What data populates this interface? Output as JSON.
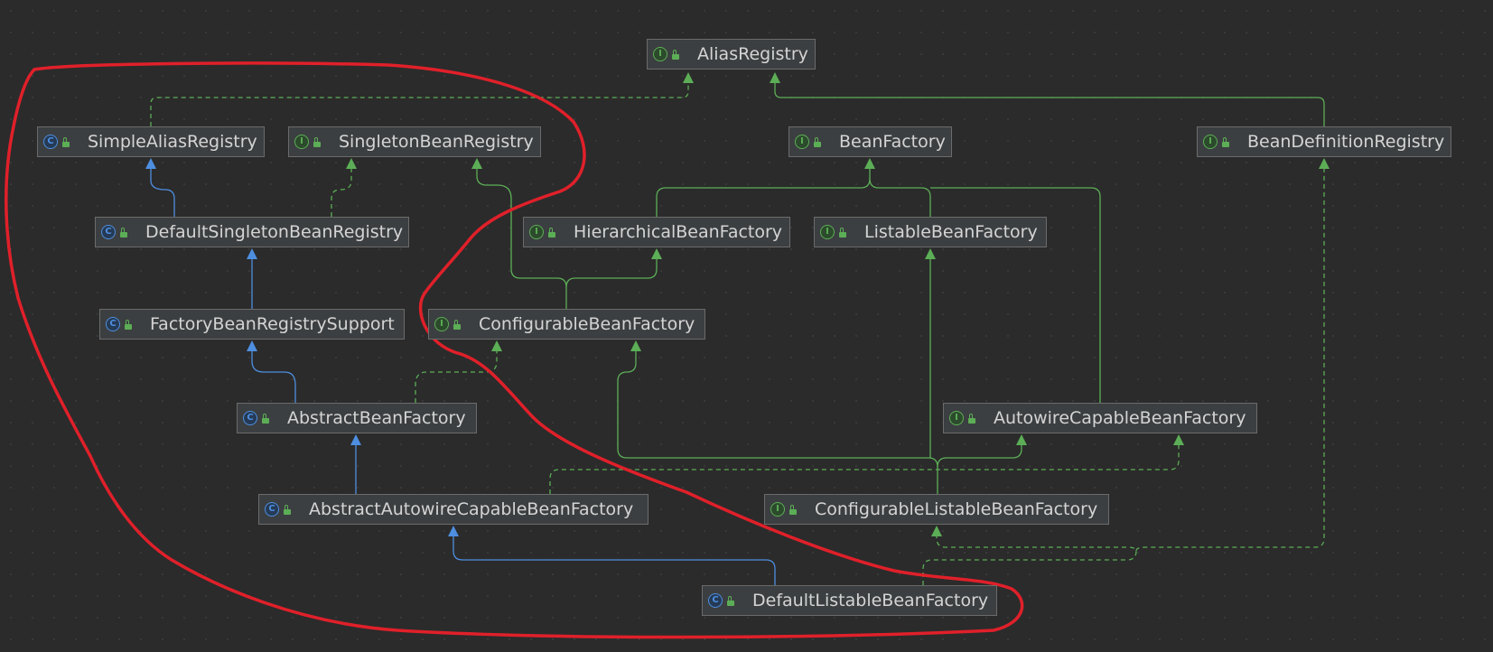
{
  "nodes": {
    "alias_registry": {
      "name": "AliasRegistry",
      "kind": "interface",
      "kind_icon": "I"
    },
    "simple_alias_registry": {
      "name": "SimpleAliasRegistry",
      "kind": "class",
      "kind_icon": "C"
    },
    "singleton_bean_registry": {
      "name": "SingletonBeanRegistry",
      "kind": "interface",
      "kind_icon": "I"
    },
    "bean_factory": {
      "name": "BeanFactory",
      "kind": "interface",
      "kind_icon": "I"
    },
    "bean_definition_registry": {
      "name": "BeanDefinitionRegistry",
      "kind": "interface",
      "kind_icon": "I"
    },
    "default_singleton_bean_registry": {
      "name": "DefaultSingletonBeanRegistry",
      "kind": "class",
      "kind_icon": "C"
    },
    "hierarchical_bean_factory": {
      "name": "HierarchicalBeanFactory",
      "kind": "interface",
      "kind_icon": "I"
    },
    "listable_bean_factory": {
      "name": "ListableBeanFactory",
      "kind": "interface",
      "kind_icon": "I"
    },
    "factory_bean_registry_support": {
      "name": "FactoryBeanRegistrySupport",
      "kind": "class",
      "kind_icon": "C"
    },
    "configurable_bean_factory": {
      "name": "ConfigurableBeanFactory",
      "kind": "interface",
      "kind_icon": "I"
    },
    "abstract_bean_factory": {
      "name": "AbstractBeanFactory",
      "kind": "class",
      "kind_icon": "C"
    },
    "autowire_capable_bean_factory": {
      "name": "AutowireCapableBeanFactory",
      "kind": "interface",
      "kind_icon": "I"
    },
    "abstract_autowire_capable_bean_factory": {
      "name": "AbstractAutowireCapableBeanFactory",
      "kind": "class",
      "kind_icon": "C"
    },
    "configurable_listable_bean_factory": {
      "name": "ConfigurableListableBeanFactory",
      "kind": "interface",
      "kind_icon": "I"
    },
    "default_listable_bean_factory": {
      "name": "DefaultListableBeanFactory",
      "kind": "class",
      "kind_icon": "C"
    }
  },
  "colors": {
    "extends_class": "#4e8ee0",
    "extends_interface": "#5cae56",
    "implements": "#5cae56",
    "annotation_freehand": "#e0202a",
    "background": "#2b2b2b",
    "node_fill": "#3c3f41",
    "node_border": "#6b6b6b",
    "node_text": "#d4d4d4"
  },
  "edges": [
    {
      "from": "simple_alias_registry",
      "to": "alias_registry",
      "type": "implements"
    },
    {
      "from": "default_singleton_bean_registry",
      "to": "simple_alias_registry",
      "type": "extends_class"
    },
    {
      "from": "default_singleton_bean_registry",
      "to": "singleton_bean_registry",
      "type": "implements"
    },
    {
      "from": "factory_bean_registry_support",
      "to": "default_singleton_bean_registry",
      "type": "extends_class"
    },
    {
      "from": "abstract_bean_factory",
      "to": "factory_bean_registry_support",
      "type": "extends_class"
    },
    {
      "from": "abstract_bean_factory",
      "to": "configurable_bean_factory",
      "type": "implements"
    },
    {
      "from": "abstract_autowire_capable_bean_factory",
      "to": "abstract_bean_factory",
      "type": "extends_class"
    },
    {
      "from": "abstract_autowire_capable_bean_factory",
      "to": "autowire_capable_bean_factory",
      "type": "implements"
    },
    {
      "from": "default_listable_bean_factory",
      "to": "abstract_autowire_capable_bean_factory",
      "type": "extends_class"
    },
    {
      "from": "default_listable_bean_factory",
      "to": "configurable_listable_bean_factory",
      "type": "implements"
    },
    {
      "from": "default_listable_bean_factory",
      "to": "bean_definition_registry",
      "type": "implements"
    },
    {
      "from": "bean_definition_registry",
      "to": "alias_registry",
      "type": "extends_interface"
    },
    {
      "from": "hierarchical_bean_factory",
      "to": "bean_factory",
      "type": "extends_interface"
    },
    {
      "from": "listable_bean_factory",
      "to": "bean_factory",
      "type": "extends_interface"
    },
    {
      "from": "autowire_capable_bean_factory",
      "to": "bean_factory",
      "type": "extends_interface"
    },
    {
      "from": "configurable_bean_factory",
      "to": "hierarchical_bean_factory",
      "type": "extends_interface"
    },
    {
      "from": "configurable_bean_factory",
      "to": "singleton_bean_registry",
      "type": "extends_interface"
    },
    {
      "from": "configurable_listable_bean_factory",
      "to": "listable_bean_factory",
      "type": "extends_interface"
    },
    {
      "from": "configurable_listable_bean_factory",
      "to": "autowire_capable_bean_factory",
      "type": "extends_interface"
    },
    {
      "from": "configurable_listable_bean_factory",
      "to": "configurable_bean_factory",
      "type": "extends_interface"
    }
  ]
}
